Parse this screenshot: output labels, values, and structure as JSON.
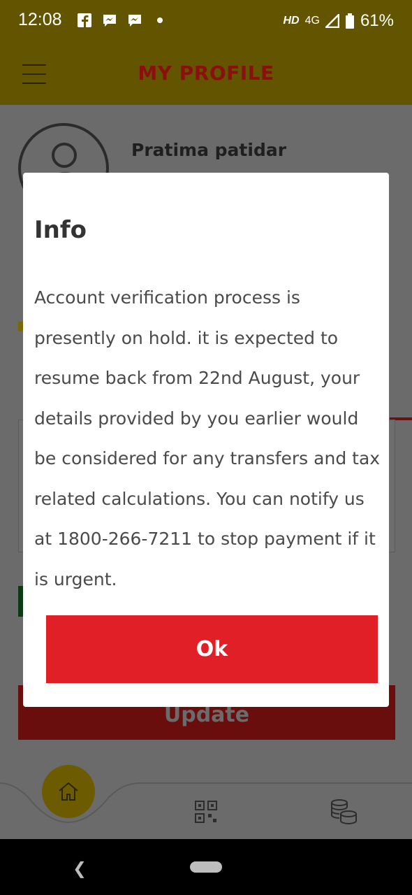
{
  "status_bar": {
    "time": "12:08",
    "hd": "HD",
    "network": "4G",
    "battery": "61%",
    "notifications": [
      "facebook-icon",
      "messenger-icon",
      "messenger-icon",
      "dot-icon"
    ]
  },
  "app_bar": {
    "title": "MY PROFILE",
    "menu_icon": "hamburger-menu-icon"
  },
  "profile": {
    "name": "Pratima patidar"
  },
  "update_button": {
    "label": "Update"
  },
  "bottom_nav": {
    "items": [
      "home-icon",
      "qr-code-icon",
      "coins-icon"
    ]
  },
  "dialog": {
    "title": "Info",
    "message": "Account verification process is presently on hold. it is expected to resume back from 22nd August, your details provided by you earlier would be considered for any transfers and tax related calculations. You can notify us at 1800-266-7211 to stop payment if it is urgent.",
    "ok_label": "Ok"
  },
  "colors": {
    "app_bar": "#635400",
    "title": "#8a1010",
    "ok_button": "#e01f26",
    "overlay": "#6b6b6b"
  }
}
